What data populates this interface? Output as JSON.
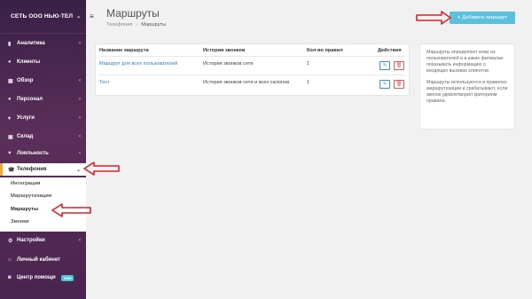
{
  "sidebar": {
    "brand": "СЕТЬ ООО НЬЮ-ТЕЛ",
    "items": [
      {
        "label": "Аналитика",
        "icon": "bar-chart-icon"
      },
      {
        "label": "Клиенты",
        "icon": "users-icon"
      },
      {
        "label": "Обзор",
        "icon": "grid-icon"
      },
      {
        "label": "Персонал",
        "icon": "person-icon"
      },
      {
        "label": "Услуги",
        "icon": "cart-icon"
      },
      {
        "label": "Склад",
        "icon": "box-icon"
      },
      {
        "label": "Лояльность",
        "icon": "heart-icon"
      },
      {
        "label": "Телефония",
        "icon": "phone-icon"
      },
      {
        "label": "Настройки",
        "icon": "gear-icon"
      },
      {
        "label": "Личный кабинет",
        "icon": "home-icon"
      },
      {
        "label": "Центр помощи",
        "icon": "help-icon",
        "badge": "new"
      }
    ],
    "telephony_sub": [
      "Интеграция",
      "Маршрутизация",
      "Маршруты",
      "Звонки"
    ]
  },
  "header": {
    "title": "Маршруты",
    "breadcrumb": [
      "Телефония",
      "Маршруты"
    ],
    "add_button": "Добавить маршрут"
  },
  "table": {
    "columns": [
      "Название маршрута",
      "История звонков",
      "Кол-во правил",
      "Действия"
    ],
    "rows": [
      {
        "name": "Маршрут для всех пользователей",
        "history": "История звонков сети",
        "rules": "1"
      },
      {
        "name": "Тест",
        "history": "История звонков сети и всех салонов",
        "rules": "1"
      }
    ]
  },
  "info": {
    "p1": "Маршруты определяют кому из пользователей и в каких филиалах показывать информацию о входящих вызовах клиентов.",
    "p2": "Маршруты используются в правилах маршрутизации и срабатывают, если звонок удовлетворил критериям правила."
  },
  "colors": {
    "accent": "#5bc0de",
    "sidebar": "#4a2450",
    "active_marker": "#f2a93b",
    "annotation": "#d9232a",
    "link": "#2f7dc8"
  }
}
